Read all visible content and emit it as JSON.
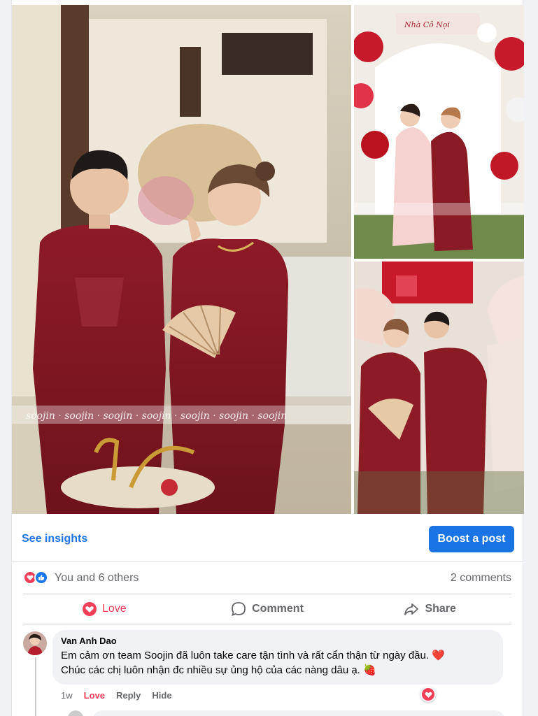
{
  "photos": {
    "watermark": "soojin",
    "signboard": "Nhà Cô Nọi"
  },
  "insights": {
    "see_insights_label": "See insights",
    "boost_label": "Boost a post"
  },
  "reactions": {
    "summary": "You and 6 others",
    "comments_count": "2 comments",
    "icons": [
      "love-icon",
      "like-icon"
    ]
  },
  "actions": {
    "love_label": "Love",
    "comment_label": "Comment",
    "share_label": "Share"
  },
  "comment": {
    "author": "Van Anh Dao",
    "line1": "Em cảm ơn team Soojin đã luôn take care tận tình và rất cẩn thận từ ngày đầu.",
    "line1_emoji": "❤️",
    "line2": "Chúc các chị luôn nhận đc nhiều sự ủng hộ của các nàng dâu ạ.",
    "line2_emoji": "🍓",
    "time": "1w",
    "love_link": "Love",
    "reply_link": "Reply",
    "hide_link": "Hide"
  },
  "colors": {
    "accent": "#1b74e4",
    "love": "#f33e58",
    "dress_red": "#8b1a24"
  }
}
